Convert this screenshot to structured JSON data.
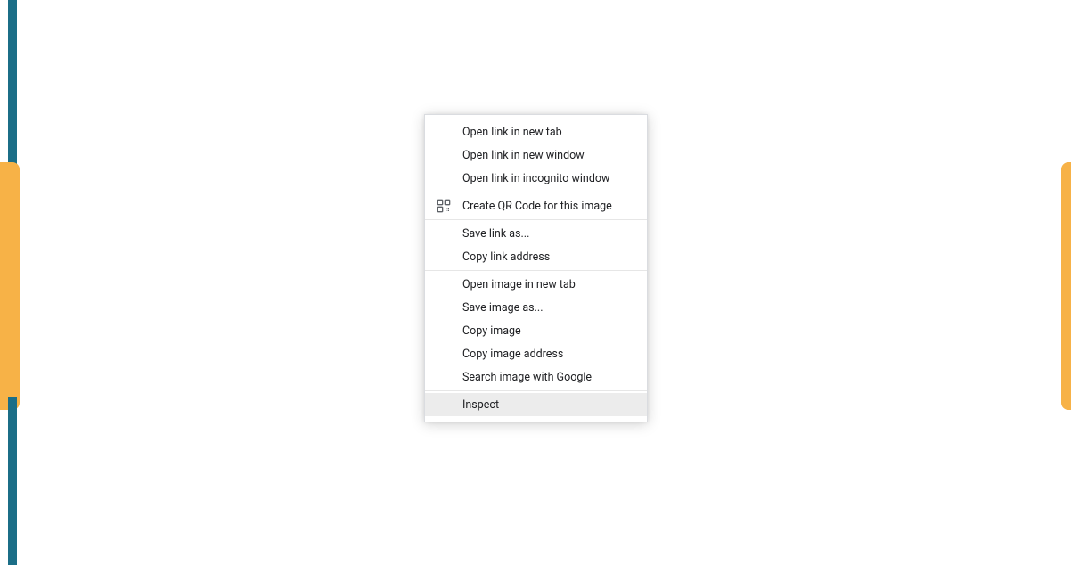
{
  "context_menu": {
    "sections": [
      {
        "items": [
          {
            "label": "Open link in new tab",
            "icon": null,
            "highlight": false
          },
          {
            "label": "Open link in new window",
            "icon": null,
            "highlight": false
          },
          {
            "label": "Open link in incognito window",
            "icon": null,
            "highlight": false
          }
        ]
      },
      {
        "items": [
          {
            "label": "Create QR Code for this image",
            "icon": "qr-icon",
            "highlight": false
          }
        ]
      },
      {
        "items": [
          {
            "label": "Save link as...",
            "icon": null,
            "highlight": false
          },
          {
            "label": "Copy link address",
            "icon": null,
            "highlight": false
          }
        ]
      },
      {
        "items": [
          {
            "label": "Open image in new tab",
            "icon": null,
            "highlight": false
          },
          {
            "label": "Save image as...",
            "icon": null,
            "highlight": false
          },
          {
            "label": "Copy image",
            "icon": null,
            "highlight": false
          },
          {
            "label": "Copy image address",
            "icon": null,
            "highlight": false
          },
          {
            "label": "Search image with Google",
            "icon": null,
            "highlight": false
          }
        ]
      },
      {
        "items": [
          {
            "label": "Inspect",
            "icon": null,
            "highlight": true
          }
        ]
      }
    ]
  }
}
